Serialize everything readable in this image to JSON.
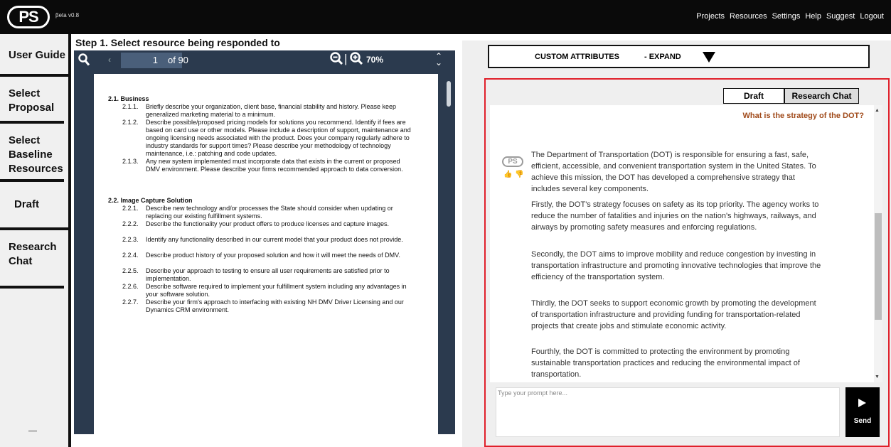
{
  "app": {
    "logo_text": "PS",
    "beta": "βeta v0.8",
    "nav": [
      "Projects",
      "Resources",
      "Settings",
      "Help",
      "Suggest",
      "Logout"
    ]
  },
  "sidebar": {
    "items": [
      "User Guide",
      "Select Proposal",
      "Select Baseline Resources",
      "Draft",
      "Research Chat"
    ]
  },
  "step": {
    "title": "Step 1. Select resource being responded to"
  },
  "viewer": {
    "page_current": "1",
    "page_of": "of 90",
    "zoom": "70%",
    "doc": [
      {
        "type": "head",
        "text": "2.1. Business"
      },
      {
        "num": "2.1.1.",
        "text": "Briefly describe your organization, client base, financial stability and history. Please keep generalized marketing material to a minimum."
      },
      {
        "num": "2.1.2.",
        "text": "Describe possible/proposed pricing models for solutions you recommend. Identify if fees are based on card use or other models. Please include a description of support, maintenance and ongoing licensing needs associated with the product. Does your company regularly adhere to industry standards for support times? Please describe your methodology of technology maintenance, i.e.: patching and code updates."
      },
      {
        "num": "2.1.3.",
        "text": "Any new system implemented must incorporate data that exists in the current or proposed DMV environment. Please describe your firms recommended approach to data conversion."
      },
      {
        "type": "head",
        "text": "2.2. Image Capture Solution"
      },
      {
        "num": "2.2.1.",
        "text": "Describe new technology and/or processes the State should consider when updating or replacing our existing fulfillment systems."
      },
      {
        "num": "2.2.2.",
        "text": "Describe the functionality your product offers to produce licenses and capture images."
      },
      {
        "num": "2.2.3.",
        "text": "Identify any functionality described in our current model that your product does not provide."
      },
      {
        "num": "2.2.4.",
        "text": "Describe product history of your proposed solution and how it will meet the needs of DMV."
      },
      {
        "num": "2.2.5.",
        "text": "Describe your approach to testing to ensure all user requirements are satisfied prior to implementation."
      },
      {
        "num": "2.2.6.",
        "text": "Describe software required to implement your fulfillment system including any advantages in your software solution."
      },
      {
        "num": "2.2.7.",
        "text": "Describe your firm's approach to interfacing with existing NH DMV Driver Licensing and our Dynamics CRM environment."
      }
    ]
  },
  "custom_attributes": {
    "label": "CUSTOM ATTRIBUTES",
    "toggle": "- EXPAND"
  },
  "tabs": {
    "draft": "Draft",
    "research_chat": "Research Chat"
  },
  "chat": {
    "user_question": "What is the strategy of the DOT?",
    "bot_logo": "PS",
    "paragraphs": [
      "The Department of Transportation (DOT) is responsible for ensuring a fast, safe, efficient, accessible, and convenient transportation system in the United States. To achieve this mission, the DOT has developed a comprehensive strategy that includes several key components.",
      "Firstly, the DOT's strategy focuses on safety as its top priority. The agency works to reduce the number of fatalities and injuries on the nation's highways, railways, and airways by promoting safety measures and enforcing regulations.",
      "Secondly, the DOT aims to improve mobility and reduce congestion by investing in transportation infrastructure and promoting innovative technologies that improve the efficiency of the transportation system.",
      "Thirdly, the DOT seeks to support economic growth by promoting the development of transportation infrastructure and providing funding for transportation-related projects that create jobs and stimulate economic activity.",
      "Fourthly, the DOT is committed to protecting the environment by promoting sustainable transportation practices and reducing the environmental impact of transportation."
    ],
    "prompt_placeholder": "Type your prompt here...",
    "send_label": "Send"
  }
}
